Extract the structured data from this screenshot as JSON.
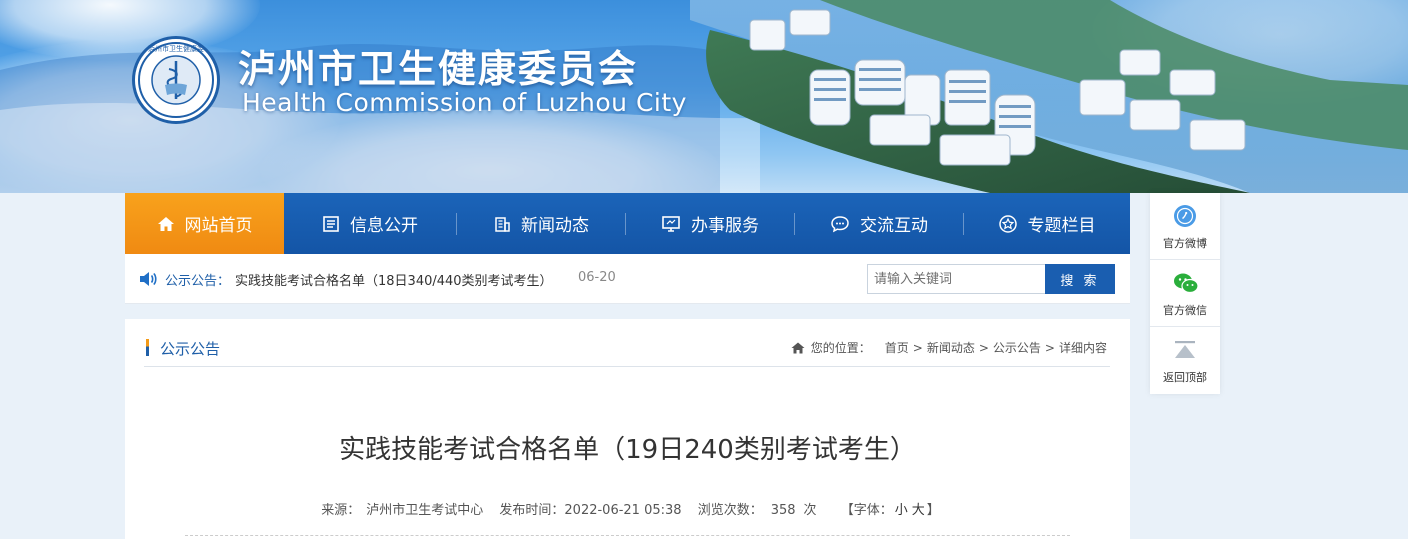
{
  "header": {
    "title_cn": "泸州市卫生健康委员会",
    "title_en": "Health Commission of Luzhou City"
  },
  "nav": {
    "items": [
      {
        "label": "网站首页",
        "icon": "home-icon",
        "active": true
      },
      {
        "label": "信息公开",
        "icon": "document-list-icon",
        "active": false
      },
      {
        "label": "新闻动态",
        "icon": "building-icon",
        "active": false
      },
      {
        "label": "办事服务",
        "icon": "monitor-icon",
        "active": false
      },
      {
        "label": "交流互动",
        "icon": "chat-bubble-icon",
        "active": false
      },
      {
        "label": "专题栏目",
        "icon": "star-badge-icon",
        "active": false
      }
    ]
  },
  "notice": {
    "label": "公示公告：",
    "text": "实践技能考试合格名单（18日340/440类别考试考生）",
    "date": "06-20"
  },
  "search": {
    "placeholder": "请输入关键词",
    "button_label": "搜 索"
  },
  "section": {
    "title": "公示公告"
  },
  "breadcrumb": {
    "lead": "您的位置：",
    "items": [
      "首页",
      "新闻动态",
      "公示公告",
      "详细内容"
    ],
    "separator": ">"
  },
  "article": {
    "title": "实践技能考试合格名单（19日240类别考试考生）",
    "source_label": "来源：",
    "source": "泸州市卫生考试中心",
    "time_label": "发布时间：",
    "time": "2022-06-21 05:38",
    "views_label": "浏览次数：",
    "views": "358",
    "views_unit": "次",
    "font_open": "【字体：",
    "font_small": "小",
    "font_large": "大",
    "font_close": "】"
  },
  "side": {
    "items": [
      {
        "label": "官方微博",
        "icon": "weibo-icon"
      },
      {
        "label": "官方微信",
        "icon": "wechat-icon"
      },
      {
        "label": "返回顶部",
        "icon": "back-to-top-icon"
      }
    ]
  },
  "colors": {
    "nav_blue": "#1b64b9",
    "nav_active_orange": "#f39a17",
    "accent_blue": "#1f5fa8",
    "wechat_green": "#2aae3b"
  }
}
